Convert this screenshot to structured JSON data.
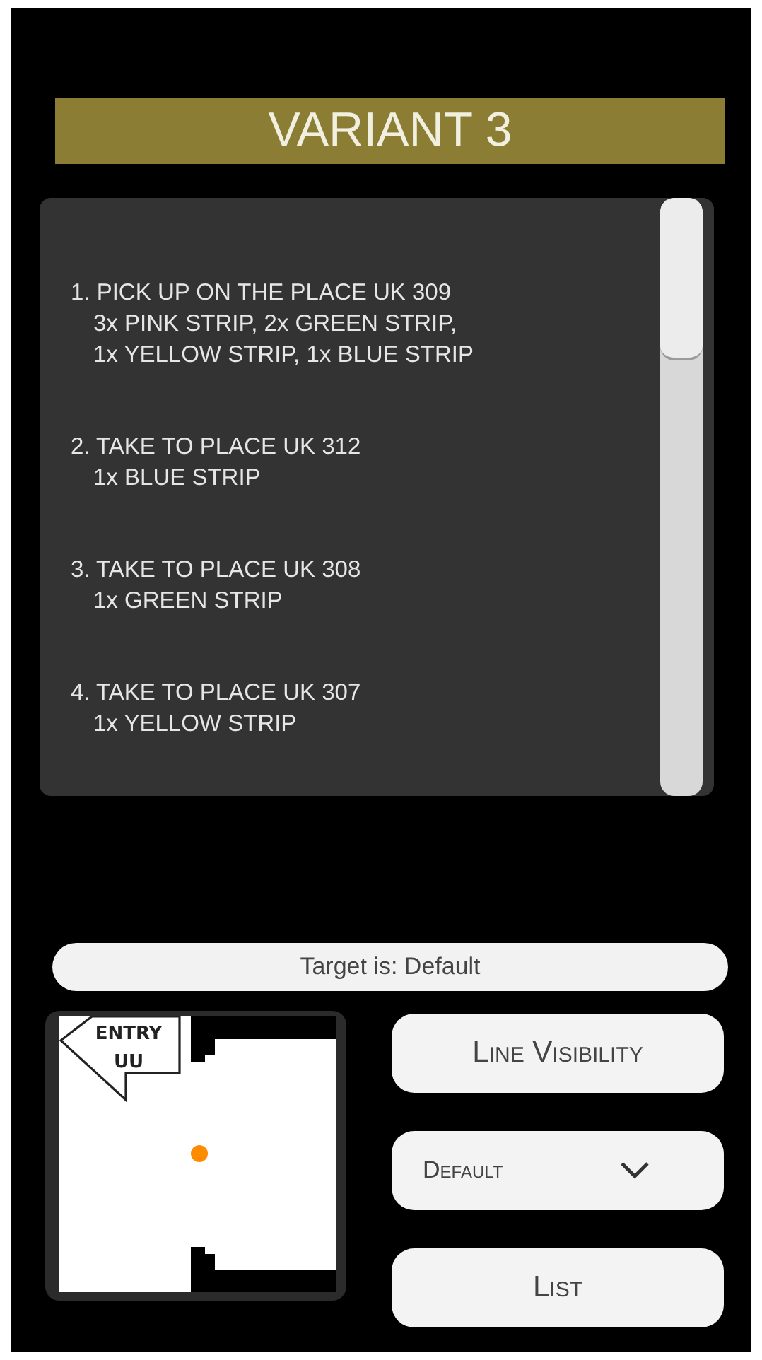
{
  "title": "VARIANT 3",
  "steps": [
    {
      "heading": "1. PICK UP ON THE PLACE UK 309",
      "details": [
        "3x PINK STRIP, 2x GREEN STRIP,",
        "1x YELLOW STRIP, 1x BLUE STRIP"
      ]
    },
    {
      "heading": "2. TAKE TO PLACE UK 312",
      "details": [
        "1x BLUE STRIP"
      ]
    },
    {
      "heading": "3. TAKE TO PLACE UK 308",
      "details": [
        "1x GREEN STRIP"
      ]
    },
    {
      "heading": "4. TAKE TO PLACE UK 307",
      "details": [
        "1x YELLOW STRIP"
      ]
    }
  ],
  "target_label": "Target is: Default",
  "map": {
    "entry_label": [
      "ENTRY",
      "UU"
    ]
  },
  "buttons": [
    {
      "kind": "button",
      "label": "Line Visibility"
    },
    {
      "kind": "dropdown",
      "label": "Default"
    },
    {
      "kind": "button",
      "label": "List"
    }
  ]
}
